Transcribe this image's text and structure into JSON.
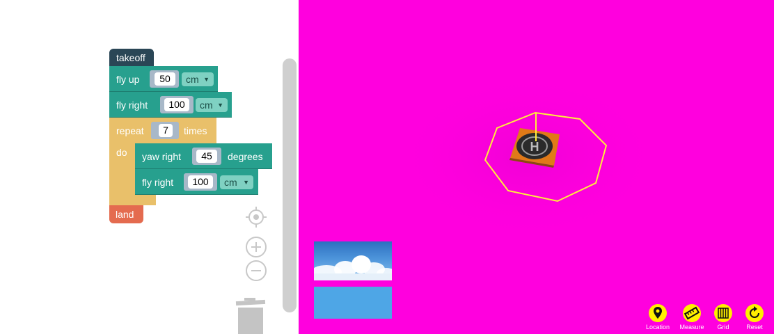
{
  "blocks": {
    "takeoff": "takeoff",
    "fly_up": {
      "label": "fly up",
      "value": "50",
      "unit": "cm"
    },
    "fly_right_1": {
      "label": "fly right",
      "value": "100",
      "unit": "cm"
    },
    "repeat": {
      "label": "repeat",
      "count": "7",
      "suffix": "times",
      "do": "do"
    },
    "yaw_right": {
      "label": "yaw right",
      "value": "45",
      "suffix": "degrees"
    },
    "fly_right_2": {
      "label": "fly right",
      "value": "100",
      "unit": "cm"
    },
    "land": "land"
  },
  "toolbar": {
    "location": "Location",
    "measure": "Measure",
    "grid": "Grid",
    "reset": "Reset"
  },
  "colors": {
    "viewport_background": "#ff00de",
    "motion_block": "#27a08e",
    "control_block": "#e9c06a",
    "takeoff_block": "#2a4656",
    "land_block": "#e46b4f",
    "tool_button": "#ffef00",
    "flight_path": "#ffef3a"
  },
  "icons": [
    "recenter-icon",
    "zoom-in-icon",
    "zoom-out-icon",
    "trash-icon",
    "location-pin-icon",
    "ruler-icon",
    "grid-icon",
    "reset-icon",
    "helipad-icon"
  ]
}
